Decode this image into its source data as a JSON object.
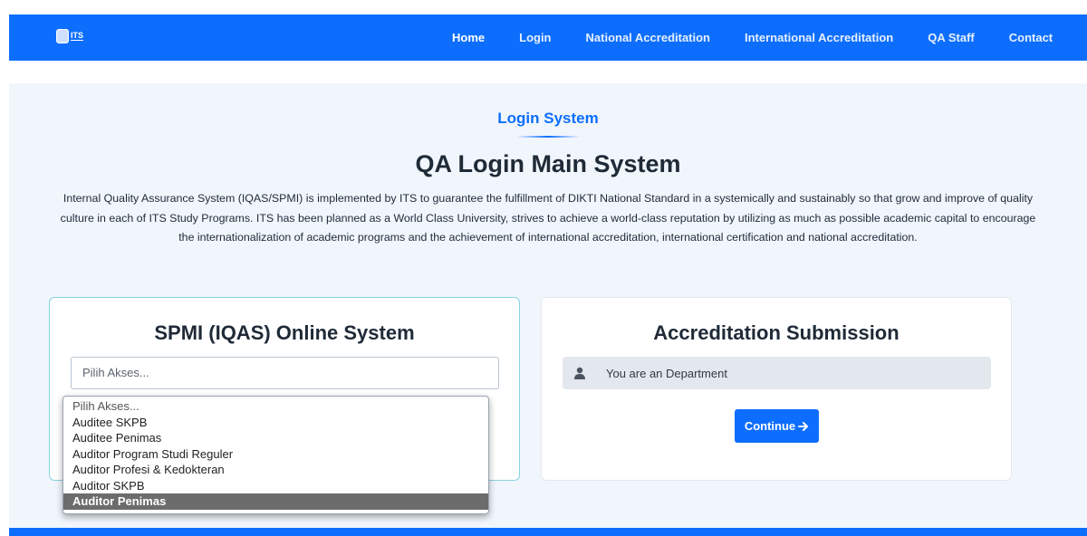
{
  "brand": {
    "logo_text": "ITS"
  },
  "nav": {
    "items": [
      {
        "label": "Home"
      },
      {
        "label": "Login"
      },
      {
        "label": "National Accreditation"
      },
      {
        "label": "International Accreditation"
      },
      {
        "label": "QA Staff"
      },
      {
        "label": "Contact"
      }
    ],
    "active": "Home"
  },
  "main": {
    "section_label": "Login System",
    "title": "QA Login Main System",
    "intro": "Internal Quality Assurance System (IQAS/SPMI) is implemented by ITS to guarantee the fulfillment of DIKTI National Standard in a systemically and sustainably so that grow and improve of quality culture in each of ITS Study Programs. ITS has been planned as a World Class University, strives to achieve a world-class reputation by utilizing as much as possible academic capital to encourage the internationalization of academic programs and the achievement of international accreditation, international certification and national accreditation."
  },
  "spmi": {
    "title": "SPMI (IQAS) Online System",
    "select_value": "Pilih Akses...",
    "options": [
      "Pilih Akses...",
      "Auditee SKPB",
      "Auditee Penimas",
      "Auditor Program Studi Reguler",
      "Auditor Profesi & Kedokteran",
      "Auditor SKPB",
      "Auditor Penimas"
    ],
    "highlighted_option": "Auditor Penimas"
  },
  "accreditation": {
    "title": "Accreditation Submission",
    "department_text": "You are an Department",
    "user_icon": "user-icon",
    "continue_label": "Continue",
    "continue_icon": "arrow-right-icon"
  },
  "colors": {
    "primary": "#0d6efd",
    "background": "#f1f6fd"
  }
}
